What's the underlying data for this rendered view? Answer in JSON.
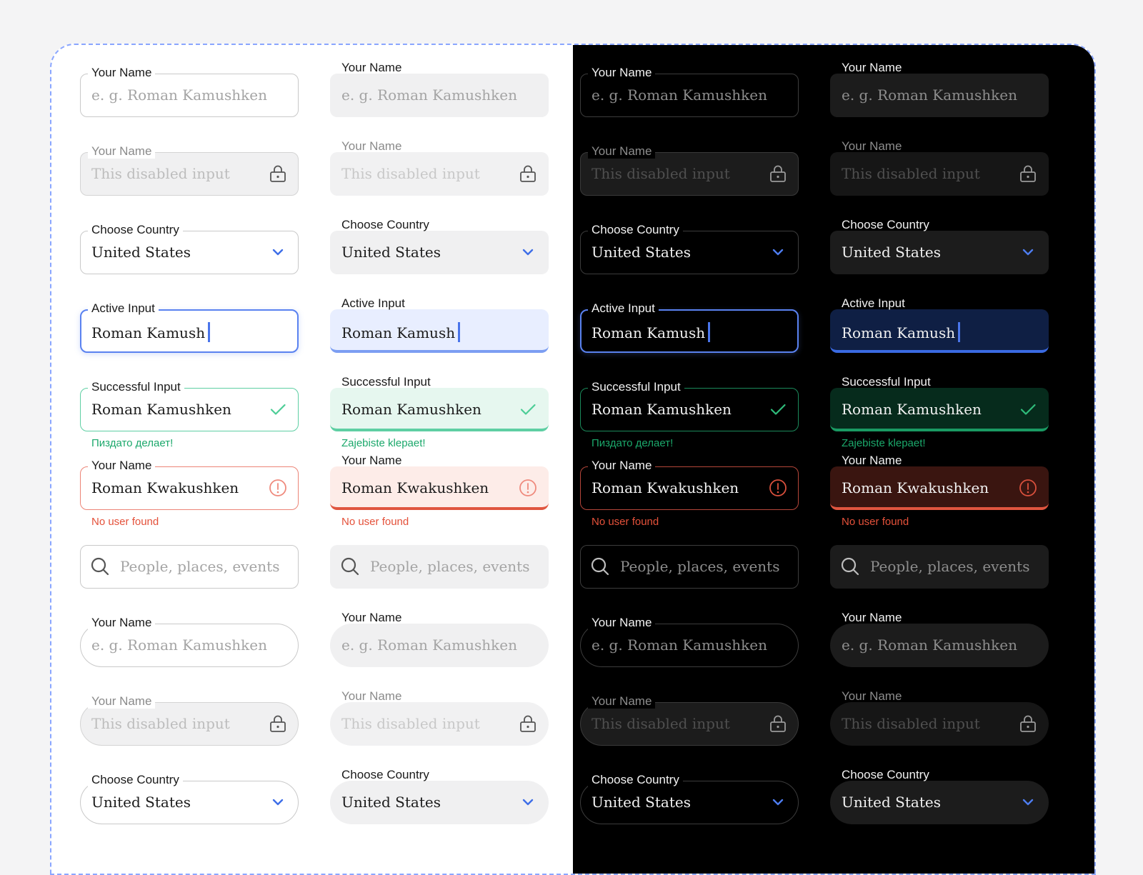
{
  "colors": {
    "page_background": "#f4f4f5",
    "dashed_frame": "#8aa6ff",
    "light_panel": "#ffffff",
    "dark_panel": "#000000",
    "active_accent": "#5a82f0",
    "success_accent": "#5ecfa3",
    "error_accent": "#e0553f",
    "select_arrow": "#3e6ee8"
  },
  "themes": [
    "light",
    "dark"
  ],
  "variants": [
    "outline",
    "filled"
  ],
  "rows": [
    {
      "kind": "placeholder",
      "label": "Your Name",
      "value": "e. g. Roman Kamushken",
      "value_is_placeholder": true,
      "icon": null
    },
    {
      "kind": "disabled",
      "label": "Your Name",
      "value": "This disabled input",
      "value_is_placeholder": false,
      "icon": "lock-icon"
    },
    {
      "kind": "select",
      "label": "Choose Country",
      "value": "United States",
      "value_is_placeholder": false,
      "icon": "chevron-down-icon"
    },
    {
      "kind": "active",
      "label": "Active Input",
      "value": "Roman Kamush",
      "value_is_placeholder": false,
      "icon": null
    },
    {
      "kind": "success",
      "label": "Successful Input",
      "value": "Roman Kamushken",
      "value_is_placeholder": false,
      "icon": "check-icon",
      "messages": {
        "outline": "Пиздато делает!",
        "filled": "Zajebiste klepaet!"
      }
    },
    {
      "kind": "error",
      "label": "Your Name",
      "value": "Roman Kwakushken",
      "value_is_placeholder": false,
      "icon": "error-circle-icon",
      "messages": {
        "outline": "No user found",
        "filled": "No user found"
      }
    },
    {
      "kind": "search",
      "label": null,
      "value": "People, places, events",
      "value_is_placeholder": true,
      "icon": "search-icon"
    },
    {
      "kind": "placeholder",
      "shape": "pill",
      "label": "Your Name",
      "value": "e. g. Roman Kamushken",
      "value_is_placeholder": true,
      "icon": null
    },
    {
      "kind": "disabled",
      "shape": "pill",
      "label": "Your Name",
      "value": "This disabled input",
      "value_is_placeholder": false,
      "icon": "lock-icon"
    },
    {
      "kind": "select",
      "shape": "pill",
      "label": "Choose Country",
      "value": "United States",
      "value_is_placeholder": false,
      "icon": "chevron-down-icon"
    }
  ]
}
